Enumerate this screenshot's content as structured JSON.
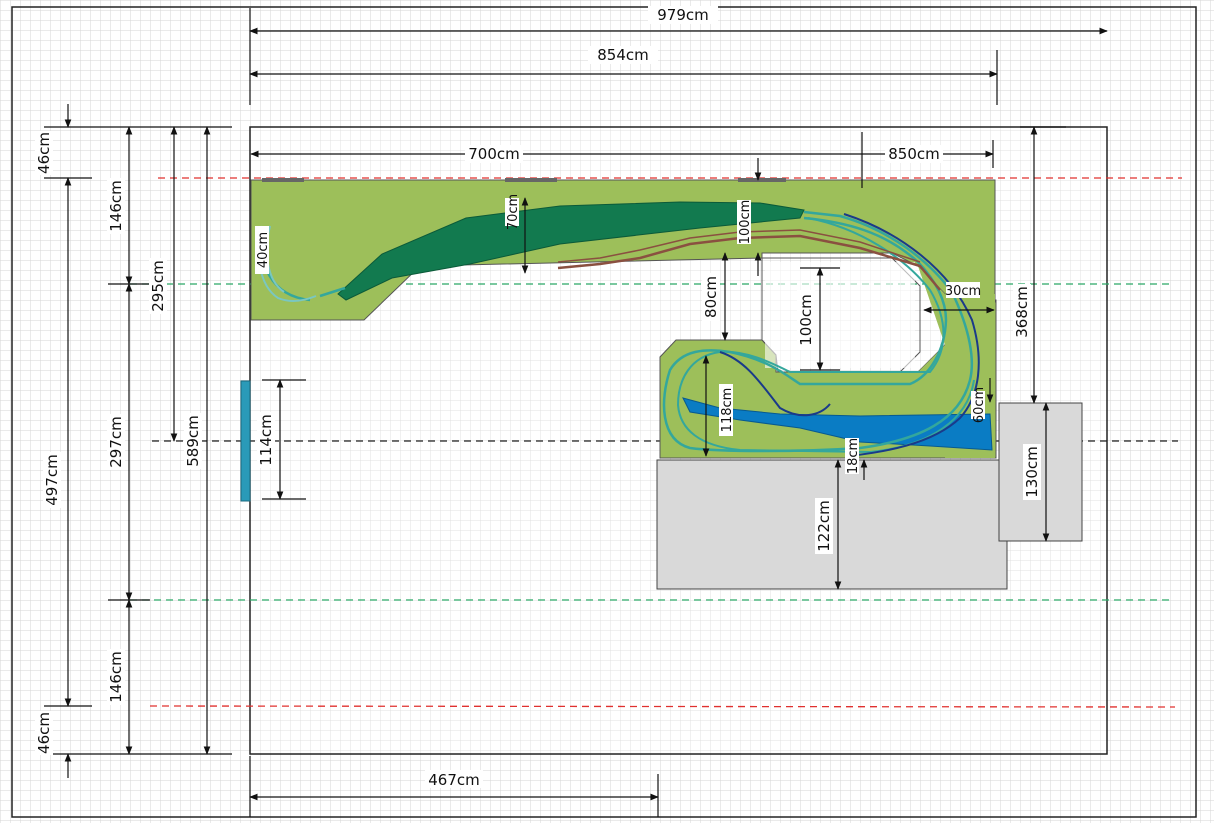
{
  "dimensions": {
    "top_total": "979cm",
    "top_inner": "854cm",
    "board_left": "700cm",
    "board_right": "850cm",
    "bottom_width": "467cm",
    "left_46_top": "46cm",
    "left_146_top": "146cm",
    "left_497": "497cm",
    "left_146_bottom": "146cm",
    "left_46_bottom": "46cm",
    "left_297": "297cm",
    "left_295": "295cm",
    "left_589": "589cm",
    "door_114": "114cm",
    "gap_80": "80cm",
    "gap_100": "100cm",
    "right_368": "368cm",
    "box_130": "130cm",
    "box_122": "122cm",
    "inner_40": "40cm",
    "inner_70": "70cm",
    "inner_60": "60cm",
    "inner_118": "118cm",
    "inner_18": "18cm",
    "inner_30": "30cm",
    "inner_100": "100cm"
  },
  "colors": {
    "grid": "#d6d6d6",
    "board_green": "#9dbf5a",
    "mountain_green": "#127a4f",
    "water_blue": "#0a7cc4",
    "track_teal": "#34a79c",
    "track_brown": "#8a5040",
    "obstacle_gray": "#d9d9d9",
    "door_blue": "#2a9ab8",
    "guide_red": "#e0302f",
    "guide_green": "#2aa866"
  }
}
